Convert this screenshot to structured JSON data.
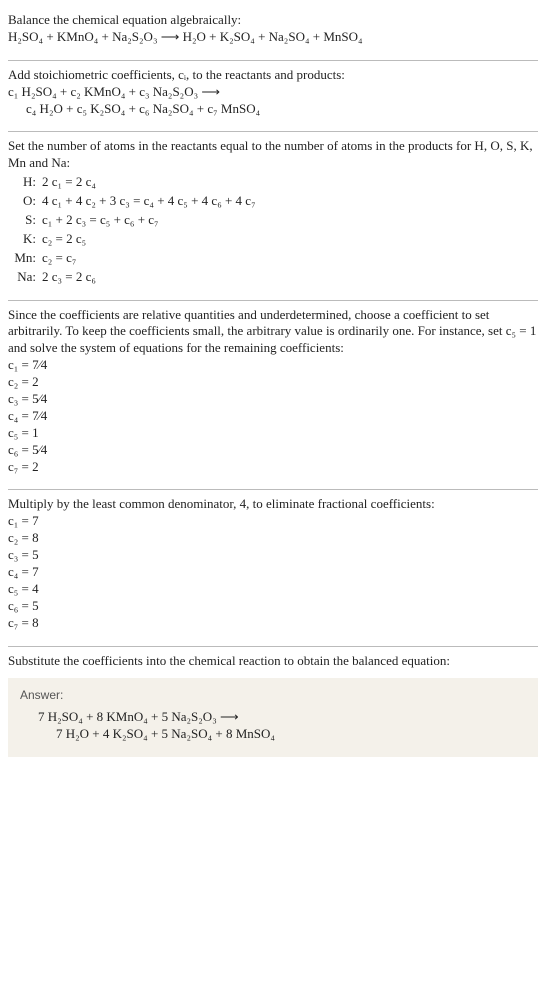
{
  "s1": {
    "t1": "Balance the chemical equation algebraically:",
    "eq": "H₂SO₄ + KMnO₄ + Na₂S₂O₃  ⟶  H₂O + K₂SO₄ + Na₂SO₄ + MnSO₄"
  },
  "s2": {
    "t1": "Add stoichiometric coefficients, cᵢ, to the reactants and products:",
    "eq1": "c₁ H₂SO₄ + c₂ KMnO₄ + c₃ Na₂S₂O₃  ⟶",
    "eq2": "c₄ H₂O + c₅ K₂SO₄ + c₆ Na₂SO₄ + c₇ MnSO₄"
  },
  "s3": {
    "t1": "Set the number of atoms in the reactants equal to the number of atoms in the products for H, O, S, K, Mn and Na:",
    "rows": [
      {
        "el": "H:",
        "eq": "2 c₁ = 2 c₄"
      },
      {
        "el": "O:",
        "eq": "4 c₁ + 4 c₂ + 3 c₃ = c₄ + 4 c₅ + 4 c₆ + 4 c₇"
      },
      {
        "el": "S:",
        "eq": "c₁ + 2 c₃ = c₅ + c₆ + c₇"
      },
      {
        "el": "K:",
        "eq": "c₂ = 2 c₅"
      },
      {
        "el": "Mn:",
        "eq": "c₂ = c₇"
      },
      {
        "el": "Na:",
        "eq": "2 c₃ = 2 c₆"
      }
    ]
  },
  "s4": {
    "t1": "Since the coefficients are relative quantities and underdetermined, choose a coefficient to set arbitrarily. To keep the coefficients small, the arbitrary value is ordinarily one. For instance, set c₅ = 1 and solve the system of equations for the remaining coefficients:",
    "c": [
      "c₁ = 7⁄4",
      "c₂ = 2",
      "c₃ = 5⁄4",
      "c₄ = 7⁄4",
      "c₅ = 1",
      "c₆ = 5⁄4",
      "c₇ = 2"
    ]
  },
  "s5": {
    "t1": "Multiply by the least common denominator, 4, to eliminate fractional coefficients:",
    "c": [
      "c₁ = 7",
      "c₂ = 8",
      "c₃ = 5",
      "c₄ = 7",
      "c₅ = 4",
      "c₆ = 5",
      "c₇ = 8"
    ]
  },
  "s6": {
    "t1": "Substitute the coefficients into the chemical reaction to obtain the balanced equation:"
  },
  "ans": {
    "label": "Answer:",
    "eq1": "7 H₂SO₄ + 8 KMnO₄ + 5 Na₂S₂O₃  ⟶",
    "eq2": "7 H₂O + 4 K₂SO₄ + 5 Na₂SO₄ + 8 MnSO₄"
  }
}
